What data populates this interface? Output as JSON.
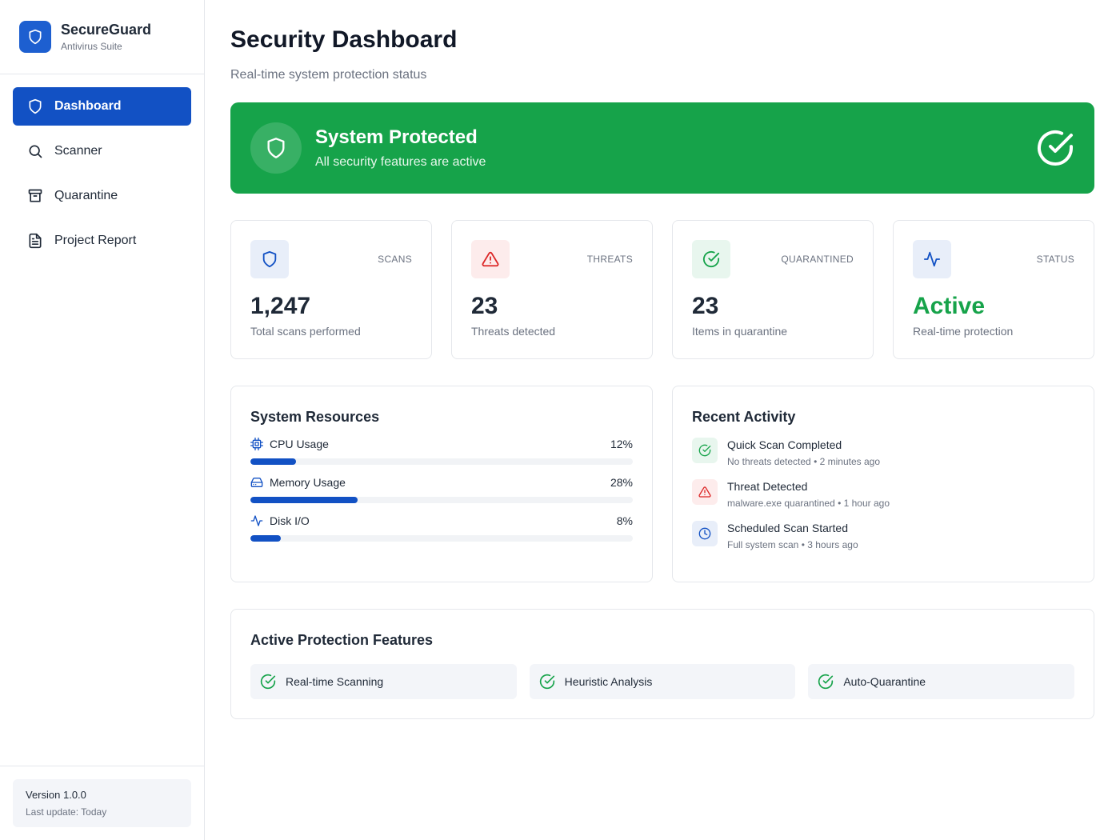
{
  "app": {
    "name": "SecureGuard",
    "subtitle": "Antivirus Suite",
    "accent": "#1251c4",
    "success": "#16a34a",
    "danger": "#dc2626"
  },
  "sidebar": {
    "items": [
      {
        "label": "Dashboard",
        "icon": "shield-icon",
        "active": true
      },
      {
        "label": "Scanner",
        "icon": "search-icon",
        "active": false
      },
      {
        "label": "Quarantine",
        "icon": "archive-icon",
        "active": false
      },
      {
        "label": "Project Report",
        "icon": "document-icon",
        "active": false
      }
    ],
    "footer": {
      "version": "Version 1.0.0",
      "last_update": "Last update: Today"
    }
  },
  "header": {
    "title": "Security Dashboard",
    "subtitle": "Real-time system protection status"
  },
  "banner": {
    "title": "System Protected",
    "subtitle": "All security features are active"
  },
  "stats": [
    {
      "label": "SCANS",
      "value": "1,247",
      "desc": "Total scans performed",
      "icon": "shield-icon"
    },
    {
      "label": "THREATS",
      "value": "23",
      "desc": "Threats detected",
      "icon": "alert-triangle-icon"
    },
    {
      "label": "QUARANTINED",
      "value": "23",
      "desc": "Items in quarantine",
      "icon": "check-circle-icon"
    },
    {
      "label": "STATUS",
      "value": "Active",
      "desc": "Real-time protection",
      "icon": "activity-icon"
    }
  ],
  "resources": {
    "title": "System Resources",
    "items": [
      {
        "name": "CPU Usage",
        "value": "12%",
        "percent": 12,
        "icon": "cpu-icon"
      },
      {
        "name": "Memory Usage",
        "value": "28%",
        "percent": 28,
        "icon": "hard-drive-icon"
      },
      {
        "name": "Disk I/O",
        "value": "8%",
        "percent": 8,
        "icon": "activity-icon"
      }
    ]
  },
  "activity": {
    "title": "Recent Activity",
    "items": [
      {
        "title": "Quick Scan Completed",
        "detail": "No threats detected",
        "time": "2 minutes ago",
        "icon": "check-circle-icon"
      },
      {
        "title": "Threat Detected",
        "detail": "malware.exe quarantined",
        "time": "1 hour ago",
        "icon": "alert-triangle-icon"
      },
      {
        "title": "Scheduled Scan Started",
        "detail": "Full system scan",
        "time": "3 hours ago",
        "icon": "clock-icon"
      }
    ]
  },
  "features": {
    "title": "Active Protection Features",
    "items": [
      {
        "label": "Real-time Scanning"
      },
      {
        "label": "Heuristic Analysis"
      },
      {
        "label": "Auto-Quarantine"
      }
    ]
  }
}
